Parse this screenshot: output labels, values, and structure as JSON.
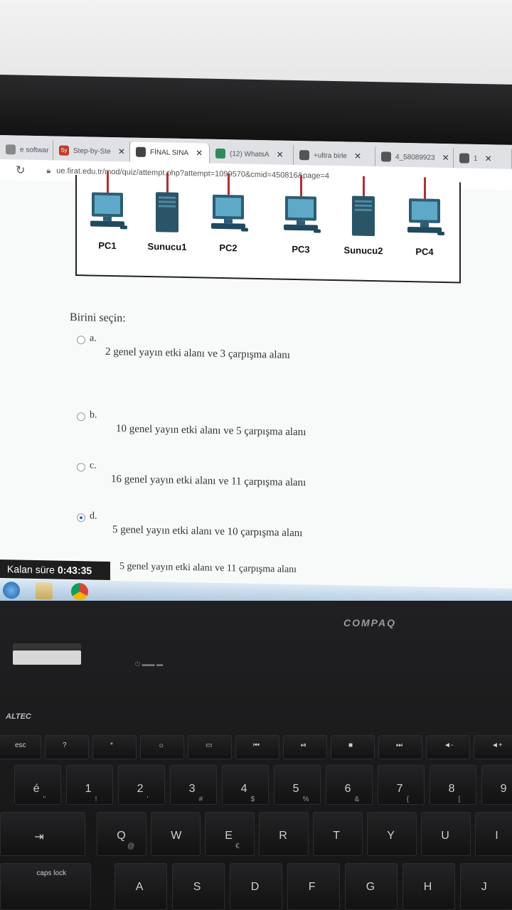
{
  "browser": {
    "tabs": [
      {
        "label": "e softwar",
        "fav_color": "#888888",
        "fav_text": ""
      },
      {
        "label": "Step-by-Ste",
        "fav_color": "#c0392b",
        "fav_text": "Sy"
      },
      {
        "label": "FİNAL SINA",
        "fav_color": "#444444",
        "fav_text": "",
        "active": true
      },
      {
        "label": "(12) WhatsA",
        "fav_color": "#2e8b57",
        "fav_text": ""
      },
      {
        "label": "+ultra birle",
        "fav_color": "#555555",
        "fav_text": ""
      },
      {
        "label": "4_58089923",
        "fav_color": "#555555",
        "fav_text": ""
      },
      {
        "label": "1",
        "fav_color": "#555555",
        "fav_text": ""
      }
    ],
    "url": "ue.firat.edu.tr/mod/quiz/attempt.php?attempt=1099570&cmid=450816&page=4"
  },
  "diagram": {
    "nodes": [
      {
        "label": "PC1",
        "kind": "pc"
      },
      {
        "label": "Sunucu1",
        "kind": "server"
      },
      {
        "label": "PC2",
        "kind": "pc"
      },
      {
        "label": "PC3",
        "kind": "pc"
      },
      {
        "label": "Sunucu2",
        "kind": "server"
      },
      {
        "label": "PC4",
        "kind": "pc"
      }
    ]
  },
  "quiz": {
    "prompt": "Birini seçin:",
    "options": [
      {
        "letter": "a.",
        "text": "2 genel yayın etki alanı ve 3 çarpışma alanı",
        "selected": false
      },
      {
        "letter": "b.",
        "text": "10 genel yayın etki alanı ve 5 çarpışma alanı",
        "selected": false
      },
      {
        "letter": "c.",
        "text": "16 genel yayın etki alanı ve 11 çarpışma alanı",
        "selected": false
      },
      {
        "letter": "d.",
        "text": "5 genel yayın etki alanı ve 10 çarpışma alanı",
        "selected": true
      },
      {
        "letter": "",
        "text": "5 genel yayın etki alanı ve 11 çarpışma alanı",
        "selected": false
      }
    ]
  },
  "timer": {
    "label": "Kalan süre",
    "value": "0:43:35"
  },
  "laptop": {
    "brand": "COMPAQ",
    "speaker_brand": "ALTEC",
    "keys_row1": [
      "esc",
      "?",
      "*",
      "☼",
      "▭",
      "⏮",
      "⏯",
      "■",
      "⏭",
      "◄-",
      "◄+"
    ],
    "keys_row2": [
      {
        "main": "é",
        "sub": "\""
      },
      {
        "main": "1",
        "sub": "!"
      },
      {
        "main": "2",
        "sub": "'"
      },
      {
        "main": "3",
        "sub": "#"
      },
      {
        "main": "4",
        "sub": "$"
      },
      {
        "main": "5",
        "sub": "%"
      },
      {
        "main": "6",
        "sub": "&"
      },
      {
        "main": "7",
        "sub": "{"
      },
      {
        "main": "8",
        "sub": "["
      },
      {
        "main": "9",
        "sub": ""
      }
    ],
    "keys_row3": [
      {
        "main": "⇥",
        "sub": ""
      },
      {
        "main": "Q",
        "sub": "@"
      },
      {
        "main": "W",
        "sub": ""
      },
      {
        "main": "E",
        "sub": "€"
      },
      {
        "main": "R",
        "sub": ""
      },
      {
        "main": "T",
        "sub": ""
      },
      {
        "main": "Y",
        "sub": ""
      },
      {
        "main": "U",
        "sub": ""
      },
      {
        "main": "I",
        "sub": ""
      }
    ],
    "keys_row4": [
      {
        "main": "caps lock",
        "sub": ""
      },
      {
        "main": "A",
        "sub": ""
      },
      {
        "main": "S",
        "sub": ""
      },
      {
        "main": "D",
        "sub": ""
      },
      {
        "main": "F",
        "sub": ""
      },
      {
        "main": "G",
        "sub": ""
      },
      {
        "main": "H",
        "sub": ""
      },
      {
        "main": "J",
        "sub": ""
      }
    ]
  }
}
